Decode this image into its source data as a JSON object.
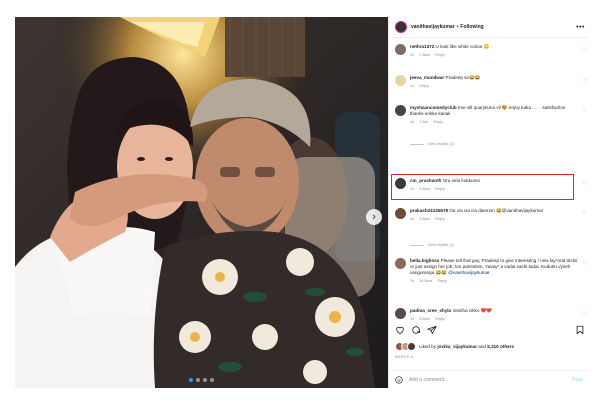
{
  "post": {
    "username": "vanithavijaykumar",
    "follow_label": "Following",
    "more_glyph": "•••",
    "liked_by_prefix": "Liked by",
    "liked_by_user": "jovika_vijaykumar",
    "liked_by_and": "and",
    "liked_by_others": "6,310 others",
    "date": "MARCH 6",
    "add_comment_placeholder": "Add a comment...",
    "post_label": "Post",
    "carousel_count": 4,
    "carousel_active": 1
  },
  "comments": [
    {
      "user": "nethra1372",
      "text": "U look like white colour 😳",
      "time": "1h",
      "likes": "2 likes",
      "reply": "Reply"
    },
    {
      "user": "jeeva_mandwar",
      "text": "Pradeep sir😂😂",
      "time": "1h",
      "likes": "",
      "reply": "Reply"
    },
    {
      "user": "myshaancomedyclub",
      "text": "Ime vill quarykuna vil 😍 enjoy kaka . . . . satisfaction thanks enkke kanak",
      "time": "1h",
      "likes": "1 like",
      "reply": "Reply",
      "view_replies": "View replies (1)"
    },
    {
      "user": "cm_prashanth",
      "text": "Oru vela irukkumo",
      "time": "1h",
      "likes": "4 likes",
      "reply": "Reply"
    },
    {
      "user": "prakash24145678",
      "text": "Oa cia cia cia daemon 😂@vanithavijaykumar",
      "time": "1h",
      "likes": "3 likes",
      "reply": "Reply",
      "view_replies": "View replies (1)"
    },
    {
      "user": "bella.bigboss",
      "text": "Please tell that guy, Pradeep to give interesting / new lay*oral tricks or just assign her job, too patriotism. Yavay* a vadai sachi tadai. Kuduttu vyinth vanguranga 😂😂",
      "mention": "@vanithavijaykumar",
      "time": "1h",
      "likes": "16 likes",
      "reply": "Reply"
    },
    {
      "user": "padma_sree_shyla",
      "text": "Vanitha cikko ❤️❤️",
      "time": "1h",
      "likes": "4 likes",
      "reply": "Reply"
    }
  ],
  "colors": {
    "highlight": "#e0242e",
    "link": "#00376b",
    "carousel_active": "#3897f0"
  },
  "icons": [
    "heart-icon",
    "comment-icon",
    "share-icon",
    "bookmark-icon",
    "smile-icon",
    "chevron-right-icon",
    "more-icon"
  ]
}
